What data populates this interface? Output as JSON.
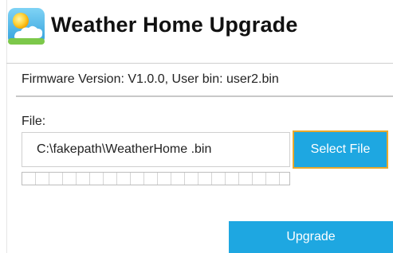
{
  "header": {
    "title": "Weather Home Upgrade",
    "icon": "weather-sun-cloud-icon"
  },
  "firmware": {
    "text": "Firmware Version: V1.0.0, User bin: user2.bin"
  },
  "file": {
    "label": "File:",
    "value": "C:\\fakepath\\WeatherHome .bin",
    "select_label": "Select File"
  },
  "progress": {
    "value": 0
  },
  "actions": {
    "upgrade_label": "Upgrade"
  },
  "colors": {
    "accent": "#1ea7e1",
    "focus_border": "#e9a92b"
  }
}
